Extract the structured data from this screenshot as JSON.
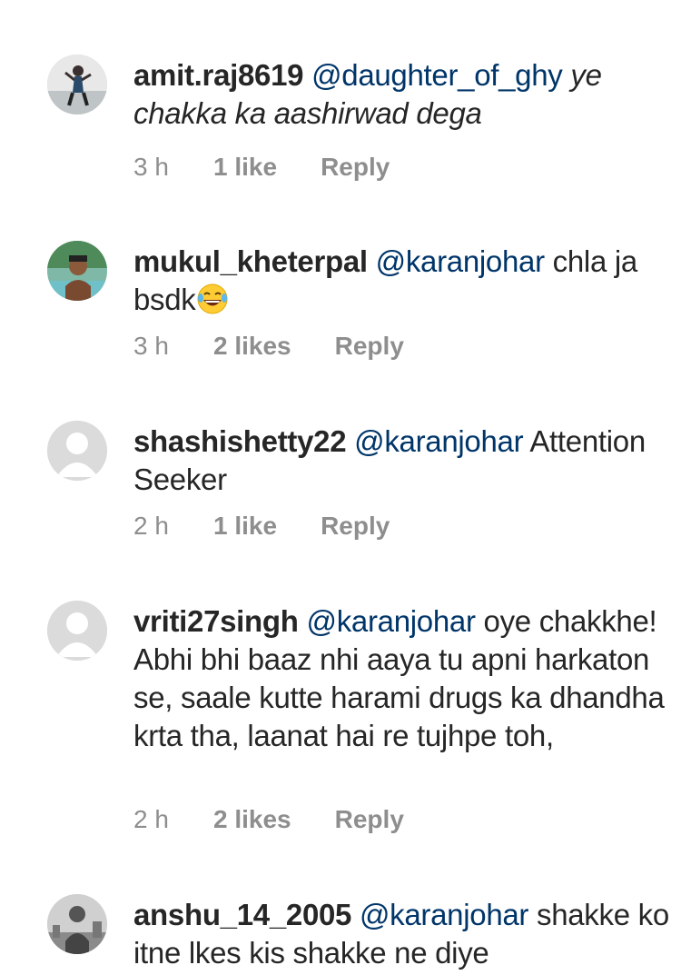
{
  "comments": [
    {
      "username": "amit.raj8619",
      "mention": "@daughter_of_ghy",
      "text": "ye chakka ka aashirwad dega",
      "time": "3 h",
      "likes": "1 like",
      "reply": "Reply"
    },
    {
      "username": "mukul_kheterpal",
      "mention": "@karanjohar",
      "text": "chla ja bsdk",
      "time": "3 h",
      "likes": "2 likes",
      "reply": "Reply",
      "emoji": "laughing-tears-emoji"
    },
    {
      "username": "shashishetty22",
      "mention": "@karanjohar",
      "text": "Attention Seeker",
      "time": "2 h",
      "likes": "1 like",
      "reply": "Reply"
    },
    {
      "username": "vriti27singh",
      "mention": "@karanjohar",
      "text": "oye chakkhe! Abhi bhi baaz nhi aaya tu apni harkaton se, saale kutte harami drugs ka dhandha krta tha, laanat hai re tujhpe toh,",
      "time": "2 h",
      "likes": "2 likes",
      "reply": "Reply"
    },
    {
      "username": "anshu_14_2005",
      "mention": "@karanjohar",
      "text": "shakke ko itne lkes kis shakke ne diye"
    }
  ],
  "colors": {
    "mention": "#003569",
    "meta": "#8e8e8e",
    "text": "#262626"
  }
}
